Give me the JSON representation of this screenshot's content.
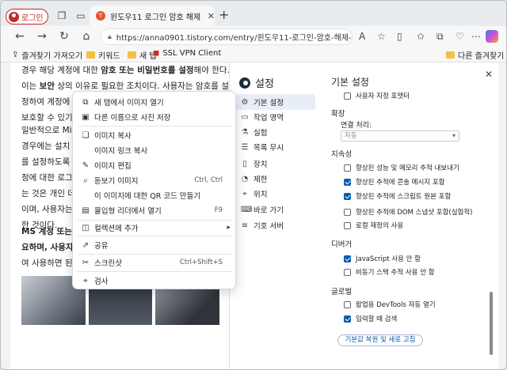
{
  "tabbar": {
    "profile_label": "로그인",
    "tab_title": "윈도우11 로그인 암호 해제 - 비밀번호",
    "tab_favicon": "T"
  },
  "address": {
    "url": "https://anna0901.tistory.com/entry/윈도우11-로그인-암호-해제-비밀번..."
  },
  "bookmarks": {
    "items": [
      {
        "label": "즐겨찾기 가져오기"
      },
      {
        "label": "키워드"
      },
      {
        "label": "새 탭"
      },
      {
        "label": "SSL VPN Client"
      }
    ],
    "other": "다른 즐겨찾기"
  },
  "article": {
    "l1_a": "경우 해당 계정에 대한 ",
    "l1_b": "암호 또는 비밀번호를 설정",
    "l1_c": "해야 한다.",
    "l2_a": "이는 ",
    "l2_b": "보안",
    "l2_c": " 상의 이유로 필요한 조치이다. 사용자는 암호를 설",
    "l3": "정하여 계정에 대한 접근을 제어하고 개인 정보를 안전하게",
    "l4": "보호할 수 있기 때",
    "l5": "일반적으로 Mic",
    "l6": "경우에는 설치 과",
    "l7": "를 설정하도록 요",
    "l8": "정에 대한 로그인",
    "l9": "는 것은 개인 데이",
    "l10": "이며, 사용자는 보",
    "l11": "한 것이다.",
    "l12": "MS 계정 또는 로",
    "l13": "요하며, 사용자의",
    "l14": "여 사용하면 된다"
  },
  "context_menu": {
    "items": [
      {
        "label": "새 탭에서 이미지 열기",
        "icon": "new-tab-icon",
        "shortcut": ""
      },
      {
        "label": "다른 이름으로 사진 저장",
        "icon": "save-image-icon",
        "shortcut": ""
      },
      {
        "label": "이미지 복사",
        "icon": "copy-image-icon",
        "shortcut": ""
      },
      {
        "label": "이미지 링크 복사",
        "icon": "",
        "shortcut": ""
      },
      {
        "label": "이미지 편집",
        "icon": "edit-image-icon",
        "shortcut": ""
      },
      {
        "label": "돋보기 이미지",
        "icon": "magnifier-icon",
        "shortcut": "Ctrl, Ctrl"
      },
      {
        "label": "이 이미지에 대한 QR 코드 만들기",
        "icon": "",
        "shortcut": ""
      },
      {
        "label": "몰입형 리더에서 열기",
        "icon": "immersive-reader-icon",
        "shortcut": "F9"
      },
      {
        "label": "컬렉션에 추가",
        "icon": "collections-icon",
        "shortcut": ""
      },
      {
        "label": "공유",
        "icon": "share-icon",
        "shortcut": ""
      },
      {
        "label": "스크린샷",
        "icon": "screenshot-icon",
        "shortcut": "Ctrl+Shift+S"
      },
      {
        "label": "검사",
        "icon": "inspect-icon",
        "shortcut": ""
      }
    ]
  },
  "devtools": {
    "title": "설정",
    "sidebar": [
      {
        "label": "기본 설정",
        "icon": "gear-icon"
      },
      {
        "label": "작업 영역",
        "icon": "folder-icon"
      },
      {
        "label": "실험",
        "icon": "flask-icon"
      },
      {
        "label": "목록 무시",
        "icon": "list-icon"
      },
      {
        "label": "장치",
        "icon": "device-icon"
      },
      {
        "label": "제한",
        "icon": "throttle-icon"
      },
      {
        "label": "위치",
        "icon": "location-icon"
      },
      {
        "label": "바로 가기",
        "icon": "keyboard-icon"
      },
      {
        "label": "기호 서버",
        "icon": "server-icon"
      }
    ],
    "main_title": "기본 설정",
    "top_item": "사용자 지정 포맷터",
    "sections": {
      "extension": "확장",
      "link_handling": "연결 처리:",
      "link_value": "자동",
      "persistence": "지속성",
      "debugger": "디버거",
      "global": "글로벌"
    },
    "persistence_items": [
      {
        "label": "향상된 성능 및 메모리 추적 내보내기",
        "checked": false
      },
      {
        "label": "향상된 추적에 콘솔 메시지 포함",
        "checked": true
      },
      {
        "label": "향상된 추적에 스크립트 원본 포함",
        "checked": true
      },
      {
        "label": "향상된 추적에 DOM 스냅샷 포함(실험적)",
        "checked": false
      },
      {
        "label": "로컬 재정의 사용",
        "checked": false
      }
    ],
    "debugger_items": [
      {
        "label": "JavaScript 사용 안 함",
        "checked": true
      },
      {
        "label": "비동기 스택 추적 사용 안 함",
        "checked": false
      }
    ],
    "global_items": [
      {
        "label": "팝업용 DevTools 자동 열기",
        "checked": false
      },
      {
        "label": "입력할 때 검색",
        "checked": true
      }
    ],
    "reset_button": "기본값 복원 및 새로 고침"
  }
}
